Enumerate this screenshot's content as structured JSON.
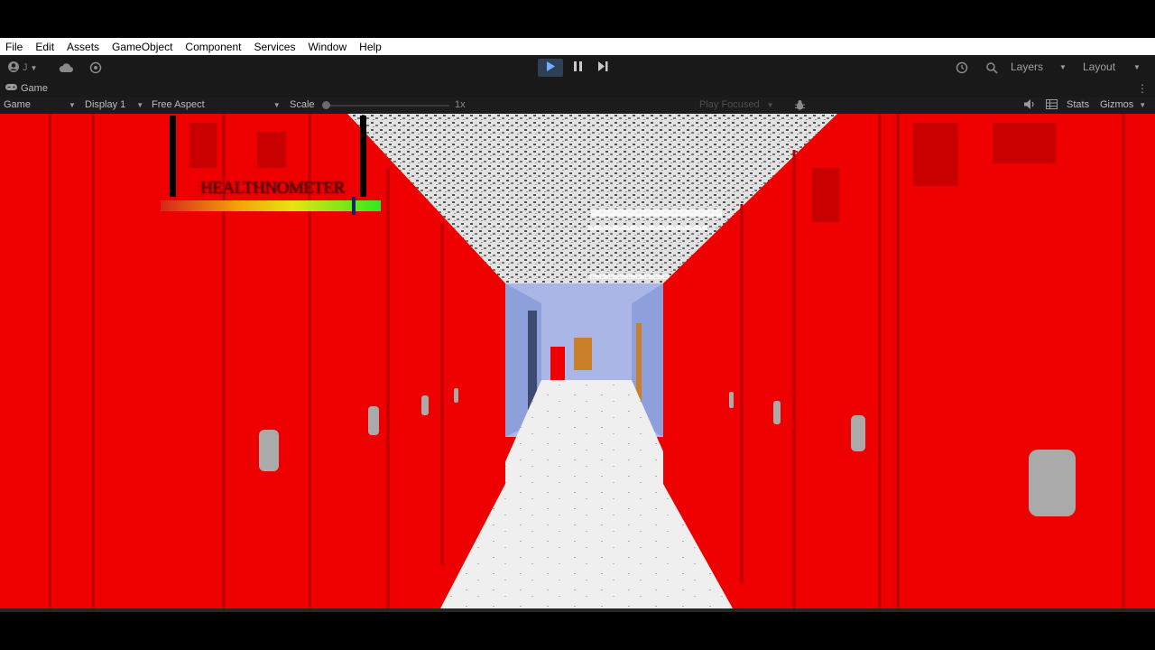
{
  "menubar": {
    "items": [
      "File",
      "Edit",
      "Assets",
      "GameObject",
      "Component",
      "Services",
      "Window",
      "Help"
    ]
  },
  "toolbar": {
    "account_icon": "account-icon",
    "cloud_icon": "cloud-icon",
    "settings_icon": "settings-icon",
    "play_icon": "play-icon",
    "pause_icon": "pause-icon",
    "step_icon": "step-icon",
    "history_icon": "history-icon",
    "search_icon": "search-icon",
    "layers_label": "Layers",
    "layout_label": "Layout",
    "play_active_color": "#6fb0ff"
  },
  "tab": {
    "label": "Game",
    "icon": "gamepad-icon"
  },
  "gamebar": {
    "view_select": "Game",
    "display_select": "Display 1",
    "aspect_select": "Free Aspect",
    "scale_label": "Scale",
    "scale_value": "1x",
    "play_focused": "Play Focused",
    "stats_label": "Stats",
    "gizmos_label": "Gizmos",
    "mute_icon": "speaker-icon",
    "stats_icon": "grid-icon",
    "bug_icon": "bug-icon"
  },
  "hud": {
    "title": "HEALTHNOMETER",
    "health_fraction": 0.89,
    "bar_colors": [
      "#d7261c",
      "#f5a10a",
      "#e8e312",
      "#34e81a"
    ]
  },
  "scene": {
    "locker_color": "#ee0000",
    "floor_color": "#eaeaea",
    "wall_color": "#aab6e6"
  }
}
